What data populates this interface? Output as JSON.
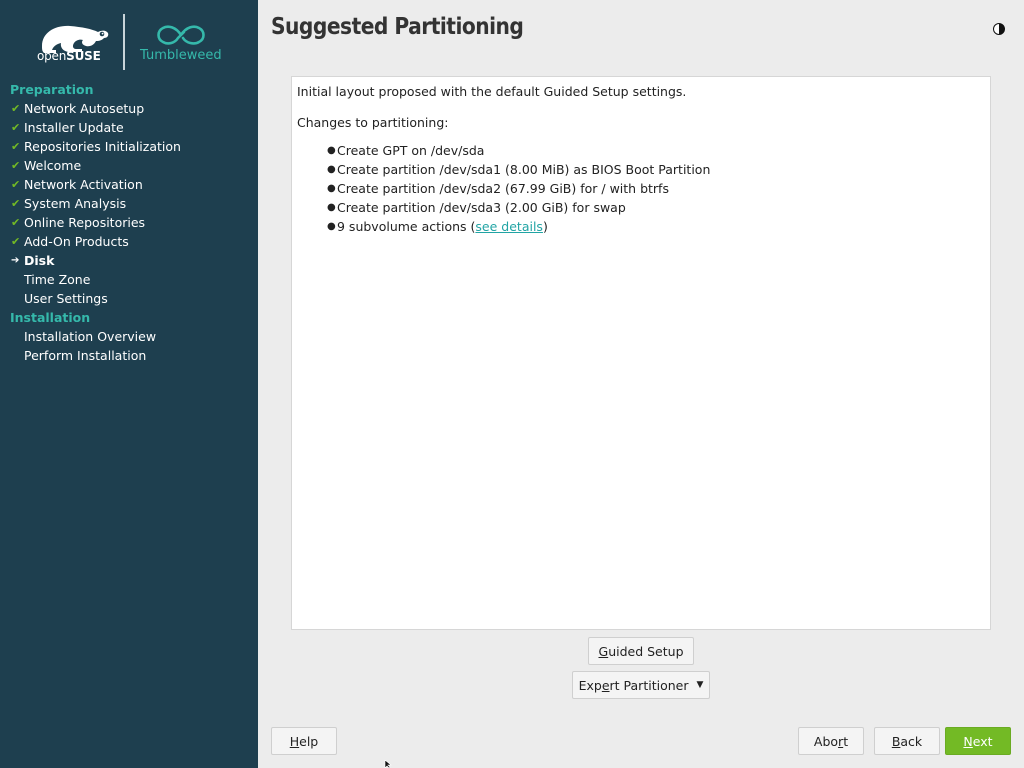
{
  "branding": {
    "opensuse_prefix": "open",
    "opensuse_suffix": "SUSE",
    "edition": "Tumbleweed"
  },
  "sidebar": {
    "sections": [
      {
        "label": "Preparation",
        "steps": [
          {
            "label": "Network Autosetup",
            "state": "done"
          },
          {
            "label": "Installer Update",
            "state": "done"
          },
          {
            "label": "Repositories Initialization",
            "state": "done"
          },
          {
            "label": "Welcome",
            "state": "done"
          },
          {
            "label": "Network Activation",
            "state": "done"
          },
          {
            "label": "System Analysis",
            "state": "done"
          },
          {
            "label": "Online Repositories",
            "state": "done"
          },
          {
            "label": "Add-On Products",
            "state": "done"
          },
          {
            "label": "Disk",
            "state": "current"
          },
          {
            "label": "Time Zone",
            "state": "pending"
          },
          {
            "label": "User Settings",
            "state": "pending"
          }
        ]
      },
      {
        "label": "Installation",
        "steps": [
          {
            "label": "Installation Overview",
            "state": "pending"
          },
          {
            "label": "Perform Installation",
            "state": "pending"
          }
        ]
      }
    ]
  },
  "page": {
    "title": "Suggested Partitioning",
    "intro": "Initial layout proposed with the default Guided Setup settings.",
    "changes_heading": "Changes to partitioning:",
    "changes": [
      "Create GPT on /dev/sda",
      "Create partition /dev/sda1 (8.00 MiB) as BIOS Boot Partition",
      "Create partition /dev/sda2 (67.99 GiB) for / with btrfs",
      "Create partition /dev/sda3 (2.00 GiB) for swap"
    ],
    "subvolume_prefix": "9 subvolume actions (",
    "subvolume_link": "see details",
    "subvolume_suffix": ")"
  },
  "buttons": {
    "guided_setup": {
      "mnemonic": "G",
      "rest": "uided Setup"
    },
    "expert_partitioner": {
      "pre": "Exp",
      "mnemonic": "e",
      "rest": "rt Partitioner"
    },
    "help": {
      "mnemonic": "H",
      "rest": "elp"
    },
    "abort": {
      "pre": "Abo",
      "mnemonic": "r",
      "rest": "t"
    },
    "back": {
      "mnemonic": "B",
      "rest": "ack"
    },
    "next": {
      "mnemonic": "N",
      "rest": "ext"
    }
  },
  "colors": {
    "sidebar_bg": "#1e3f4f",
    "accent": "#35b9ab",
    "check": "#73ba25",
    "next_button": "#73ba25"
  },
  "icons": {
    "theme_toggle": "half-moon-icon",
    "done_mark": "checkmark-icon",
    "current_mark": "arrow-right-icon"
  }
}
